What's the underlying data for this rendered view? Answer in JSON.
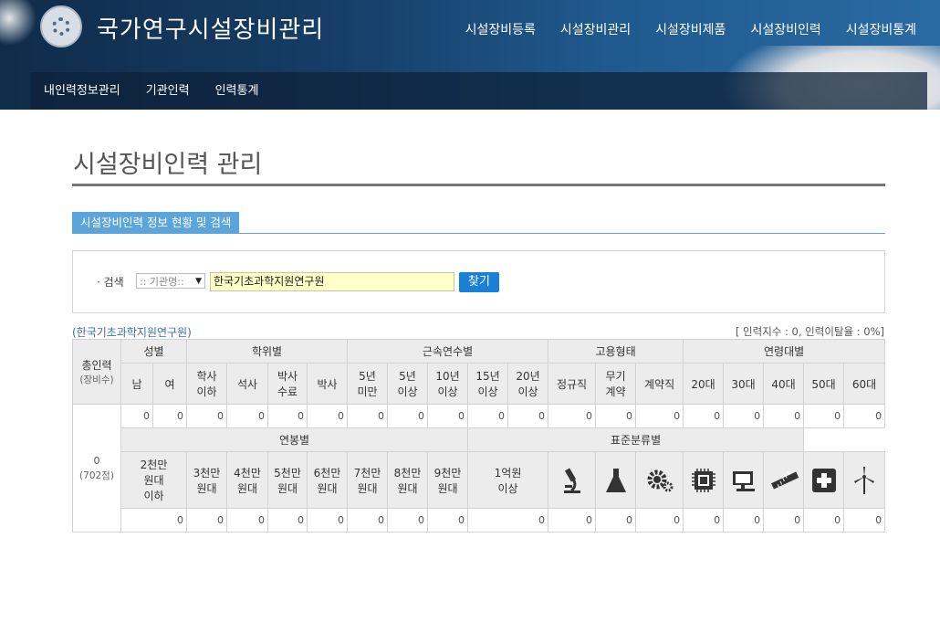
{
  "site": {
    "title": "국가연구시설장비관리"
  },
  "gnb": [
    "시설장비등록",
    "시설장비관리",
    "시설장비제품",
    "시설장비인력",
    "시설장비통계"
  ],
  "subnav": [
    "내인력정보관리",
    "기관인력",
    "인력통계"
  ],
  "page": {
    "title": "시설장비인력 관리",
    "section_tab": "시설장비인력 정보 현황 및 검색"
  },
  "search": {
    "label": "· 검색",
    "select_value": ":: 기관명::",
    "input_value": "한국기초과학지원연구원",
    "button": "찾기"
  },
  "result": {
    "org": "(한국기초과학지원연구원)",
    "summary": "[ 인력지수 : 0, 인력이탈율 : 0%]"
  },
  "table": {
    "total_header": "총인력",
    "total_sub_header": "(장비수)",
    "total_value": "0",
    "total_equipment": "(702점)",
    "groups1": [
      "성별",
      "학위별",
      "근속연수별",
      "고용형태",
      "연령대별"
    ],
    "sub1": [
      "남",
      "여",
      "학사\n이하",
      "석사",
      "박사\n수료",
      "박사",
      "5년\n미만",
      "5년\n이상",
      "10년\n이상",
      "15년\n이상",
      "20년\n이상",
      "정규직",
      "무기\n계약",
      "계약직",
      "20대",
      "30대",
      "40대",
      "50대",
      "60대"
    ],
    "values1": [
      "0",
      "0",
      "0",
      "0",
      "0",
      "0",
      "0",
      "0",
      "0",
      "0",
      "0",
      "0",
      "0",
      "0",
      "0",
      "0",
      "0",
      "0",
      "0"
    ],
    "groups2": [
      "연봉별",
      "표준분류별"
    ],
    "sub2": [
      "2천만\n원대\n이하",
      "3천만\n원대",
      "4천만\n원대",
      "5천만\n원대",
      "6천만\n원대",
      "7천만\n원대",
      "8천만\n원대",
      "9천만\n원대",
      "1억원\n이상"
    ],
    "icons2": [
      "microscope-icon",
      "flask-icon",
      "gear-icon",
      "chip-icon",
      "computer-icon",
      "ruler-icon",
      "medical-cross-icon",
      "wind-turbine-icon"
    ],
    "values2": [
      "0",
      "0",
      "0",
      "0",
      "0",
      "0",
      "0",
      "0",
      "0",
      "0",
      "0",
      "0",
      "0",
      "0",
      "0",
      "0",
      "0"
    ]
  }
}
